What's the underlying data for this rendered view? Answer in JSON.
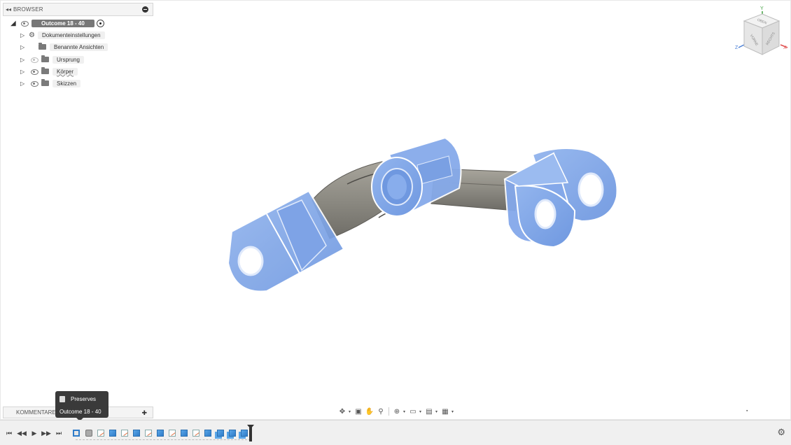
{
  "browser": {
    "title": "BROWSER",
    "collapse_icon": "double-left-arrow-icon",
    "root": {
      "label": "Outcome 18 - 40"
    },
    "items": [
      {
        "label": "Dokumenteinstellungen",
        "icon": "gear-icon"
      },
      {
        "label": "Benannte Ansichten",
        "icon": "folder-icon"
      },
      {
        "label": "Ursprung",
        "icon": "folder-icon"
      },
      {
        "label": "Körper",
        "icon": "folder-icon"
      },
      {
        "label": "Skizzen",
        "icon": "folder-icon"
      }
    ]
  },
  "viewcube": {
    "faces": [
      "OBEN",
      "VORNE",
      "RECHTS"
    ],
    "axes": {
      "x": "X",
      "y": "Y",
      "z": "Z"
    },
    "colors": {
      "x": "#e05050",
      "y": "#40a040",
      "z": "#4a7fd6"
    }
  },
  "comments": {
    "title": "KOMMENTARE"
  },
  "tooltip": {
    "title": "Preserves",
    "subtitle": "Outcome 18 - 40"
  },
  "navbar": {
    "icons": [
      "orbit-icon",
      "look-at-icon",
      "pan-icon",
      "zoom-icon",
      "fit-icon",
      "display-settings-icon",
      "grid-icon",
      "viewports-icon"
    ]
  },
  "timeline": {
    "controls": [
      "skip-to-start-icon",
      "step-back-icon",
      "play-icon",
      "step-forward-icon",
      "skip-to-end-icon"
    ],
    "features": [
      "body-selected",
      "body-grey",
      "sketch",
      "extrude",
      "sketch",
      "extrude",
      "sketch",
      "extrude",
      "sketch",
      "extrude",
      "sketch",
      "extrude",
      "double",
      "double",
      "double"
    ]
  },
  "colors": {
    "accent": "#2f7cc9",
    "part_blue": "#7fa6e6",
    "link_grey": "#8c8a82"
  }
}
